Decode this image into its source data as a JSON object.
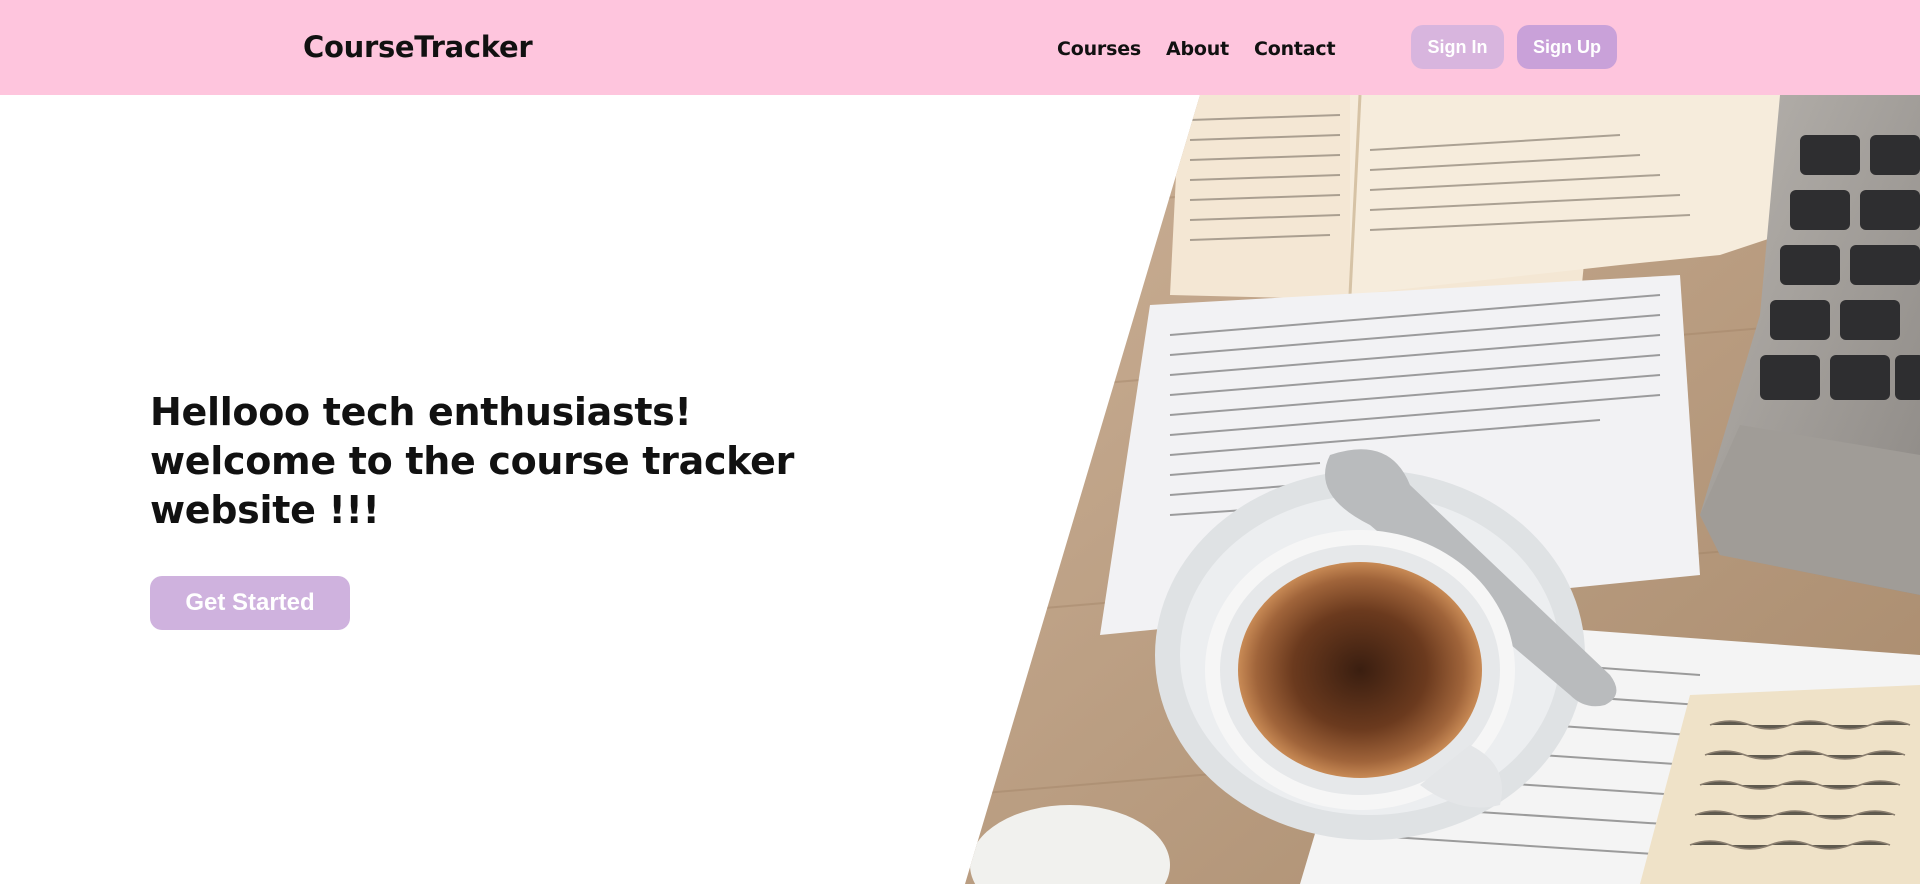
{
  "header": {
    "brand": "CourseTracker",
    "nav": [
      {
        "label": "Courses"
      },
      {
        "label": "About"
      },
      {
        "label": "Contact"
      }
    ],
    "signin_label": "Sign In",
    "signup_label": "Sign Up"
  },
  "hero": {
    "title_lines": [
      "Hellooo tech enthusiasts!",
      "welcome to the course tracker",
      "website !!!"
    ],
    "cta_label": "Get Started",
    "image_subject": "coffee-cup-books-laptop-photo"
  },
  "colors": {
    "nav_bg": "#fec5dd",
    "signin_bg": "#d8b5de",
    "signup_bg": "#c9a1d9",
    "cta_bg": "#cfb2de"
  }
}
